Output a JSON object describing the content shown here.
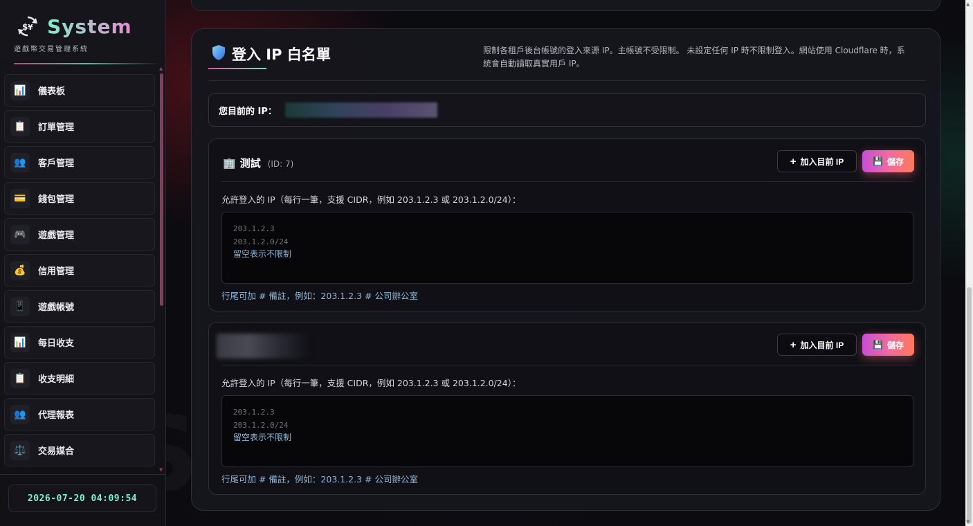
{
  "brand": {
    "title": "System",
    "subtitle": "遊戲幣交易管理系統",
    "logo_icon": "recycle-dollar-icon"
  },
  "sidebar": {
    "items": [
      {
        "label": "儀表板",
        "icon": "bar-chart-icon",
        "glyph": "📊"
      },
      {
        "label": "訂單管理",
        "icon": "clipboard-icon",
        "glyph": "📋"
      },
      {
        "label": "客戶管理",
        "icon": "users-icon",
        "glyph": "👥"
      },
      {
        "label": "錢包管理",
        "icon": "credit-card-icon",
        "glyph": "💳"
      },
      {
        "label": "遊戲管理",
        "icon": "gamepad-icon",
        "glyph": "🎮"
      },
      {
        "label": "信用管理",
        "icon": "money-bag-icon",
        "glyph": "💰"
      },
      {
        "label": "遊戲帳號",
        "icon": "mobile-phone-icon",
        "glyph": "📱"
      },
      {
        "label": "每日收支",
        "icon": "bar-chart-icon",
        "glyph": "📊"
      },
      {
        "label": "收支明細",
        "icon": "clipboard-icon",
        "glyph": "📋"
      },
      {
        "label": "代理報表",
        "icon": "users-icon",
        "glyph": "👥"
      },
      {
        "label": "交易媒合",
        "icon": "scale-icon",
        "glyph": "⚖️"
      }
    ],
    "clock": "2026-07-20 04:09:54"
  },
  "panel": {
    "title": "登入 IP 白名單",
    "title_icon": "shield-icon",
    "description": "限制各租戶後台帳號的登入來源 IP。主帳號不受限制。 未設定任何 IP 時不限制登入。網站使用 Cloudflare 時，系統會自動讀取真實用戶 IP。",
    "current_ip_label": "您目前的 IP："
  },
  "tenants": [
    {
      "icon": "building-icon",
      "name": "測試",
      "id_text": "(ID: 7)",
      "add_ip_label": "加入目前 IP",
      "save_label": "儲存",
      "field_label": "允許登入的 IP（每行一筆，支援 CIDR，例如 203.1.2.3 或 203.1.2.0/24）：",
      "placeholder": "203.1.2.3\n203.1.2.0/24",
      "placeholder_note": "留空表示不限制",
      "hint": "行尾可加 # 備註，例如：203.1.2.3 # 公司辦公室"
    },
    {
      "icon": "building-icon",
      "name": "",
      "id_text": "",
      "add_ip_label": "加入目前 IP",
      "save_label": "儲存",
      "field_label": "允許登入的 IP（每行一筆，支援 CIDR，例如 203.1.2.3 或 203.1.2.0/24）：",
      "placeholder": "203.1.2.3\n203.1.2.0/24",
      "placeholder_note": "留空表示不限制",
      "hint": "行尾可加 # 備註，例如：203.1.2.3 # 公司辦公室"
    }
  ],
  "watermark": "STANG.PRO",
  "colors": {
    "accent_teal": "#7ef0c8",
    "accent_pink": "#e88ad0",
    "save_gradient_start": "#c64fd6",
    "save_gradient_end": "#ff7a5a",
    "hint_blue": "#8fb8d8"
  }
}
